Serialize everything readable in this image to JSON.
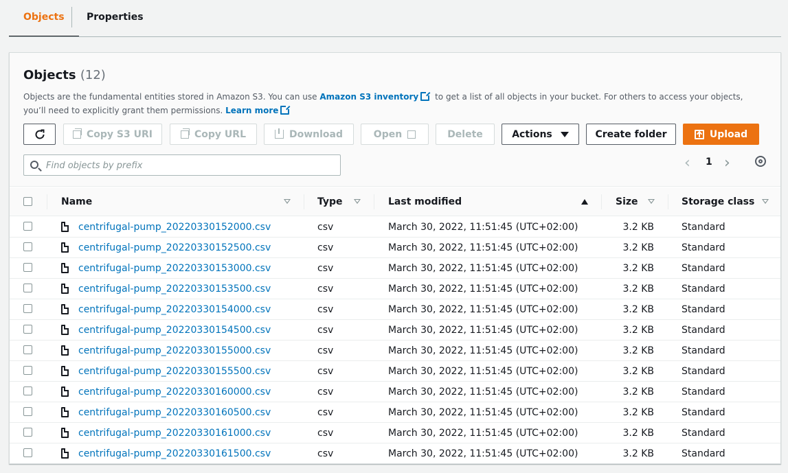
{
  "tabs": [
    {
      "label": "Objects"
    },
    {
      "label": "Properties"
    }
  ],
  "panel": {
    "title": "Objects",
    "count": "(12)",
    "description_1": "Objects are the fundamental entities stored in Amazon S3. You can use",
    "inventory_link": "Amazon S3 inventory",
    "description_2": "to get a list of all objects in your bucket. For others to access your objects, you’ll need to explicitly grant them permissions.",
    "learn_more": "Learn more"
  },
  "toolbar": {
    "copy_s3_uri": "Copy S3 URI",
    "copy_url": "Copy URL",
    "download": "Download",
    "open": "Open",
    "delete": "Delete",
    "actions": "Actions",
    "create_folder": "Create folder",
    "upload": "Upload"
  },
  "search": {
    "placeholder": "Find objects by prefix",
    "value": ""
  },
  "pager": {
    "current_page": "1"
  },
  "table": {
    "columns": [
      "Name",
      "Type",
      "Last modified",
      "Size",
      "Storage class"
    ],
    "rows": [
      {
        "name": "centrifugal-pump_20220330152000.csv",
        "type": "csv",
        "modified": "March 30, 2022, 11:51:45 (UTC+02:00)",
        "size": "3.2 KB",
        "class": "Standard"
      },
      {
        "name": "centrifugal-pump_20220330152500.csv",
        "type": "csv",
        "modified": "March 30, 2022, 11:51:45 (UTC+02:00)",
        "size": "3.2 KB",
        "class": "Standard"
      },
      {
        "name": "centrifugal-pump_20220330153000.csv",
        "type": "csv",
        "modified": "March 30, 2022, 11:51:45 (UTC+02:00)",
        "size": "3.2 KB",
        "class": "Standard"
      },
      {
        "name": "centrifugal-pump_20220330153500.csv",
        "type": "csv",
        "modified": "March 30, 2022, 11:51:45 (UTC+02:00)",
        "size": "3.2 KB",
        "class": "Standard"
      },
      {
        "name": "centrifugal-pump_20220330154000.csv",
        "type": "csv",
        "modified": "March 30, 2022, 11:51:45 (UTC+02:00)",
        "size": "3.2 KB",
        "class": "Standard"
      },
      {
        "name": "centrifugal-pump_20220330154500.csv",
        "type": "csv",
        "modified": "March 30, 2022, 11:51:45 (UTC+02:00)",
        "size": "3.2 KB",
        "class": "Standard"
      },
      {
        "name": "centrifugal-pump_20220330155000.csv",
        "type": "csv",
        "modified": "March 30, 2022, 11:51:45 (UTC+02:00)",
        "size": "3.2 KB",
        "class": "Standard"
      },
      {
        "name": "centrifugal-pump_20220330155500.csv",
        "type": "csv",
        "modified": "March 30, 2022, 11:51:45 (UTC+02:00)",
        "size": "3.2 KB",
        "class": "Standard"
      },
      {
        "name": "centrifugal-pump_20220330160000.csv",
        "type": "csv",
        "modified": "March 30, 2022, 11:51:45 (UTC+02:00)",
        "size": "3.2 KB",
        "class": "Standard"
      },
      {
        "name": "centrifugal-pump_20220330160500.csv",
        "type": "csv",
        "modified": "March 30, 2022, 11:51:45 (UTC+02:00)",
        "size": "3.2 KB",
        "class": "Standard"
      },
      {
        "name": "centrifugal-pump_20220330161000.csv",
        "type": "csv",
        "modified": "March 30, 2022, 11:51:45 (UTC+02:00)",
        "size": "3.2 KB",
        "class": "Standard"
      },
      {
        "name": "centrifugal-pump_20220330161500.csv",
        "type": "csv",
        "modified": "March 30, 2022, 11:51:45 (UTC+02:00)",
        "size": "3.2 KB",
        "class": "Standard"
      }
    ]
  },
  "icons": {
    "refresh": "refresh-icon",
    "copy": "copy-icon",
    "download": "download-icon",
    "external": "external-link-icon",
    "caret": "caret-down-icon",
    "upload": "upload-icon",
    "search": "search-icon",
    "settings": "gear-icon",
    "file": "file-icon"
  },
  "colors": {
    "accent": "#ec7211",
    "link": "#0073bb",
    "text": "#16191f",
    "muted": "#545b64",
    "disabled": "#aab7b8"
  }
}
